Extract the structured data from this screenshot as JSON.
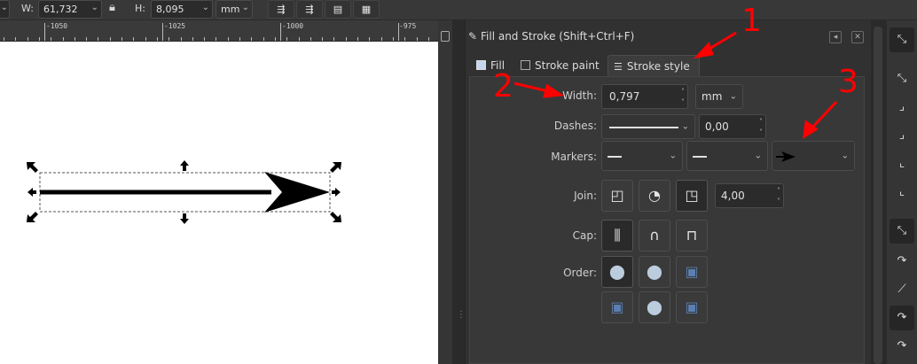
{
  "toolbar": {
    "w_label": "W:",
    "w_value": "61,732",
    "lock_icon": "lock-icon",
    "h_label": "H:",
    "h_value": "8,095",
    "unit": "mm",
    "buttons": [
      "align-icon",
      "align-icon",
      "align-icon",
      "align-icon"
    ]
  },
  "ruler": {
    "labels": [
      "-1050",
      "-1025",
      "-1000",
      "-975"
    ]
  },
  "panel": {
    "title": "Fill and Stroke (Shift+Ctrl+F)",
    "tabs": [
      {
        "label": "Fill",
        "icon": "fill-swatch-icon"
      },
      {
        "label": "Stroke paint",
        "icon": "stroke-swatch-icon"
      },
      {
        "label": "Stroke style",
        "icon": "stroke-style-icon"
      }
    ],
    "width_label": "Width:",
    "width_value": "0,797",
    "width_unit": "mm",
    "dashes_label": "Dashes:",
    "dashes_offset": "0,00",
    "markers_label": "Markers:",
    "join_label": "Join:",
    "miter_value": "4,00",
    "cap_label": "Cap:",
    "order_label": "Order:"
  },
  "annotations": {
    "n1": "1",
    "n2": "2",
    "n3": "3",
    "color": "#ff0000"
  }
}
